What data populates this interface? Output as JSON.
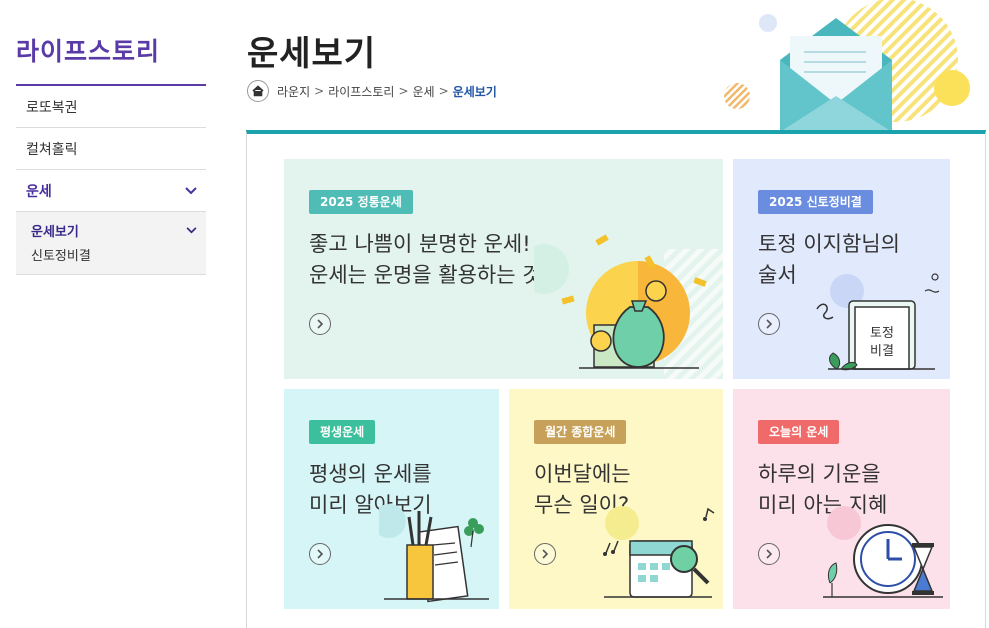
{
  "sidebar": {
    "brand": "라이프스토리",
    "items": [
      {
        "label": "로또복권"
      },
      {
        "label": "컬쳐홀릭"
      },
      {
        "label": "운세"
      }
    ],
    "sub_items": [
      {
        "label": "운세보기"
      },
      {
        "label": "신토정비결"
      }
    ]
  },
  "header": {
    "title": "운세보기",
    "breadcrumb": [
      "라운지",
      "라이프스토리",
      "운세",
      "운세보기"
    ]
  },
  "cards": [
    {
      "badge": "2025 정통운세",
      "line1": "좋고 나쁨이 분명한 운세!",
      "line2": "운세는 운명을 활용하는 것",
      "bg": "#e3f4ef",
      "badge_color": "#4fbcb5"
    },
    {
      "badge": "2025 신토정비결",
      "line1": "토정 이지함님의",
      "line2": "술서",
      "bg": "#e1e9fc",
      "badge_color": "#6a8de0",
      "book_label_1": "토정",
      "book_label_2": "비결"
    },
    {
      "badge": "평생운세",
      "line1": "평생의 운세를",
      "line2": "미리 알아보기",
      "bg": "#d6f5f7",
      "badge_color": "#3bbf9c"
    },
    {
      "badge": "월간 종합운세",
      "line1": "이번달에는",
      "line2": "무슨 일이?",
      "bg": "#fdf8c6",
      "badge_color": "#c7a15a"
    },
    {
      "badge": "오늘의 운세",
      "line1": "하루의 기운을",
      "line2": "미리 아는 지혜",
      "bg": "#fce1ea",
      "badge_color": "#f06a6a"
    }
  ],
  "icons": {
    "home": "home-icon",
    "chevron": "chevron-down-icon",
    "arrow": "arrow-right-circle-icon",
    "money_bag": "money-bag-icon",
    "book": "book-icon",
    "pencil_cup": "pencil-cup-icon",
    "calendar": "calendar-icon",
    "clock": "clock-icon",
    "envelope": "envelope-icon"
  }
}
